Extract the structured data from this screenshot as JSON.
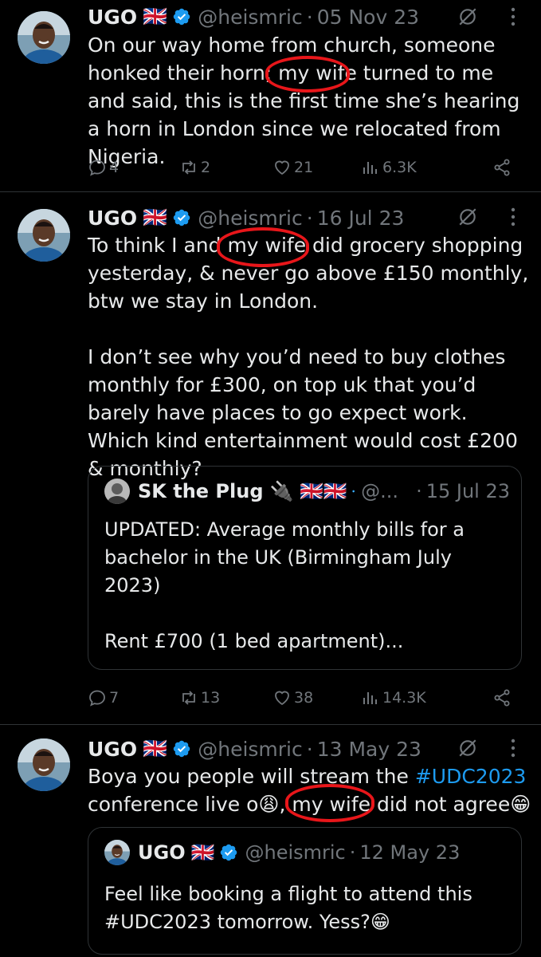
{
  "tweets": [
    {
      "name": "UGO",
      "flag": "🇬🇧",
      "handle": "@heismric",
      "dot": "·",
      "date": "05 Nov 23",
      "text_before": "On our way home from church, someone honked their horn; ",
      "highlight": "my wife",
      "text_after": " turned to me and said, this is the first time she’s hearing a horn in London since we relocated from Nigeria.",
      "replies": "4",
      "reposts": "2",
      "likes": "21",
      "views": "6.3K"
    },
    {
      "name": "UGO",
      "flag": "🇬🇧",
      "handle": "@heismric",
      "dot": "·",
      "date": "16 Jul 23",
      "text_before": "To think I and ",
      "highlight": "my wife",
      "text_after": " did grocery shopping yesterday, & never go above £150 monthly, btw we stay in London.\n\nI don’t see why you’d need to buy clothes monthly for £300, on top uk that you’d barely have places to go expect work. Which kind entertainment would cost £200 & monthly?",
      "quote": {
        "name": "SK the Plug",
        "badges": "🔌 🇬🇧🇬🇧",
        "handle": "@...",
        "dot": "·",
        "date": "15 Jul 23",
        "text": "UPDATED: Average monthly bills for a bachelor in the UK (Birmingham July 2023)\n\nRent £700 (1 bed apartment)..."
      },
      "replies": "7",
      "reposts": "13",
      "likes": "38",
      "views": "14.3K"
    },
    {
      "name": "UGO",
      "flag": "🇬🇧",
      "handle": "@heismric",
      "dot": "·",
      "date": "13 May 23",
      "text_a": "Boya you people will stream the ",
      "hashtag": "#UDC2023",
      "text_b": " conference live o😩, ",
      "highlight": "my wife",
      "text_c": " did not agree😁",
      "quote": {
        "name": "UGO",
        "flag": "🇬🇧",
        "handle": "@heismric",
        "dot": "·",
        "date": "12 May 23",
        "text": "Feel like booking a flight to attend this #UDC2023 tomorrow. Yess?😁"
      }
    }
  ],
  "colors": {
    "background": "#000000",
    "text": "#e7e9ea",
    "muted": "#71767b",
    "accent": "#1d9bf0",
    "annotation": "#e8161a"
  },
  "icons": [
    "verified-badge-icon",
    "grok-icon",
    "more-icon",
    "reply-icon",
    "repost-icon",
    "like-icon",
    "views-icon",
    "share-icon"
  ]
}
